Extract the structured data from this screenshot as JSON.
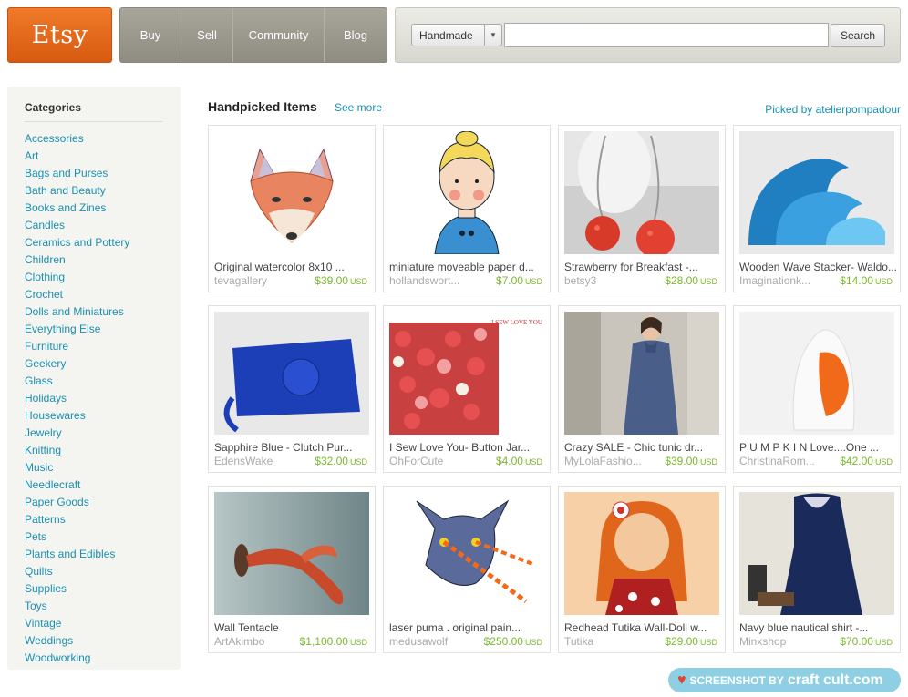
{
  "header": {
    "logo": "Etsy",
    "nav": [
      "Buy",
      "Sell",
      "Community",
      "Blog"
    ],
    "search": {
      "category": "Handmade",
      "query": "",
      "placeholder": "",
      "button_label": "Search"
    }
  },
  "sidebar": {
    "title": "Categories",
    "items": [
      "Accessories",
      "Art",
      "Bags and Purses",
      "Bath and Beauty",
      "Books and Zines",
      "Candles",
      "Ceramics and Pottery",
      "Children",
      "Clothing",
      "Crochet",
      "Dolls and Miniatures",
      "Everything Else",
      "Furniture",
      "Geekery",
      "Glass",
      "Holidays",
      "Housewares",
      "Jewelry",
      "Knitting",
      "Music",
      "Needlecraft",
      "Paper Goods",
      "Patterns",
      "Pets",
      "Plants and Edibles",
      "Quilts",
      "Supplies",
      "Toys",
      "Vintage",
      "Weddings",
      "Woodworking"
    ]
  },
  "main": {
    "title": "Handpicked Items",
    "see_more": "See more",
    "picked_by": "Picked by atelierpompadour",
    "items": [
      {
        "title": "Original watercolor 8x10 ...",
        "shop": "tevagallery",
        "price": "$39.00",
        "currency": "USD",
        "image": "fox-illustration"
      },
      {
        "title": "miniature moveable paper d...",
        "shop": "hollandswort...",
        "price": "$7.00",
        "currency": "USD",
        "image": "paper-doll-girl"
      },
      {
        "title": "Strawberry for Breakfast -...",
        "shop": "betsy3",
        "price": "$28.00",
        "currency": "USD",
        "image": "red-earrings"
      },
      {
        "title": "Wooden Wave Stacker- Waldo...",
        "shop": "Imaginationk...",
        "price": "$14.00",
        "currency": "USD",
        "image": "blue-wave-stacker"
      },
      {
        "title": "Sapphire Blue - Clutch Pur...",
        "shop": "EdensWake",
        "price": "$32.00",
        "currency": "USD",
        "image": "blue-clutch"
      },
      {
        "title": "I Sew Love You- Button Jar...",
        "shop": "OhForCute",
        "price": "$4.00",
        "currency": "USD",
        "image": "button-jar",
        "image_text": "I SEW LOVE YOU"
      },
      {
        "title": "Crazy SALE - Chic tunic dr...",
        "shop": "MyLolaFashio...",
        "price": "$39.00",
        "currency": "USD",
        "image": "tunic-dress"
      },
      {
        "title": "P U M P K I N Love....One ...",
        "shop": "ChristinaRom...",
        "price": "$42.00",
        "currency": "USD",
        "image": "orange-vase"
      },
      {
        "title": "Wall Tentacle",
        "shop": "ArtAkimbo",
        "price": "$1,100.00",
        "currency": "USD",
        "image": "wall-tentacle"
      },
      {
        "title": "laser puma . original pain...",
        "shop": "medusawolf",
        "price": "$250.00",
        "currency": "USD",
        "image": "laser-puma"
      },
      {
        "title": "Redhead Tutika Wall-Doll w...",
        "shop": "Tutika",
        "price": "$29.00",
        "currency": "USD",
        "image": "redhead-doll"
      },
      {
        "title": "Navy blue nautical shirt -...",
        "shop": "Minxshop",
        "price": "$70.00",
        "currency": "USD",
        "image": "navy-dress"
      }
    ]
  },
  "watermark": {
    "prefix": "SCREENSHOT BY",
    "brand": "craft cult.com"
  },
  "colors": {
    "link": "#1b8fb0",
    "price": "#7cb82f",
    "logo": "#e8691c"
  }
}
